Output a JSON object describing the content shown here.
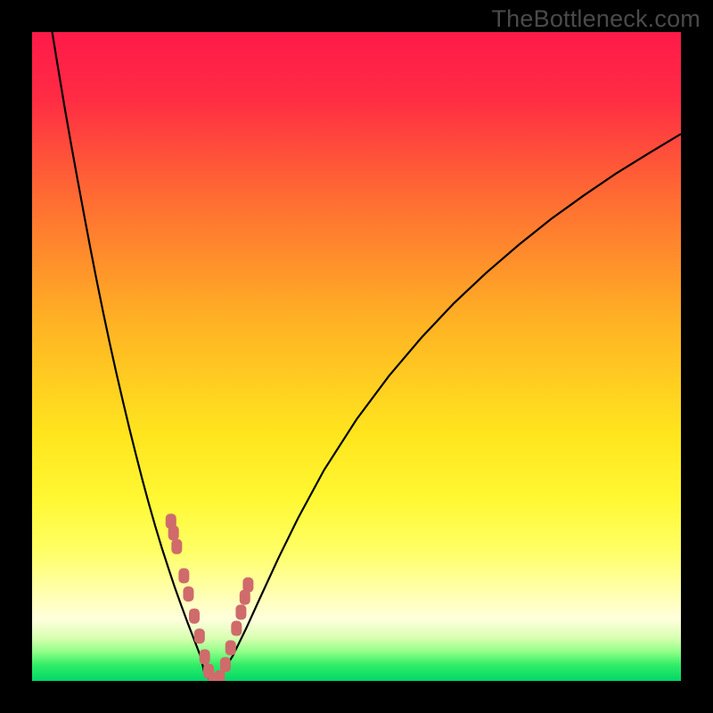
{
  "watermark": "TheBottleneck.com",
  "colors": {
    "frame": "#000000",
    "curve": "#000000",
    "marker_fill": "#cf6b6b",
    "marker_stroke": "#cf6b6b"
  },
  "gradient_stops": [
    {
      "offset": 0.0,
      "color": "#ff1a49"
    },
    {
      "offset": 0.1,
      "color": "#ff2b44"
    },
    {
      "offset": 0.25,
      "color": "#ff6a33"
    },
    {
      "offset": 0.45,
      "color": "#ffb324"
    },
    {
      "offset": 0.62,
      "color": "#ffe51e"
    },
    {
      "offset": 0.72,
      "color": "#fff833"
    },
    {
      "offset": 0.8,
      "color": "#ffff66"
    },
    {
      "offset": 0.86,
      "color": "#ffffaa"
    },
    {
      "offset": 0.905,
      "color": "#ffffdd"
    },
    {
      "offset": 0.935,
      "color": "#d6ffb0"
    },
    {
      "offset": 0.955,
      "color": "#90ff88"
    },
    {
      "offset": 0.975,
      "color": "#33ee66"
    },
    {
      "offset": 1.0,
      "color": "#00d76a"
    }
  ],
  "chart_data": {
    "type": "line",
    "title": "",
    "xlabel": "",
    "ylabel": "",
    "xlim": [
      0,
      100
    ],
    "ylim": [
      0,
      100
    ],
    "note": "Bottleneck-style V-curve. x is a normalized hardware balance parameter (0–100). y is bottleneck percentage (0 = perfect balance at the notch, 100 = fully bottlenecked). Background hue encodes the same y value (green≈0, red≈100). Values estimated from gridless figure.",
    "series": [
      {
        "name": "left-branch",
        "x": [
          3.1,
          4,
          5,
          6,
          7,
          8,
          9,
          10,
          11,
          12,
          13,
          14,
          15,
          16,
          17,
          18,
          19,
          20,
          21,
          22,
          23,
          24,
          25,
          26,
          26.5
        ],
        "y": [
          100,
          94.5,
          88.5,
          82.8,
          77.3,
          71.9,
          66.6,
          61.5,
          56.6,
          51.9,
          47.4,
          43.1,
          38.9,
          34.9,
          31.0,
          27.3,
          23.8,
          20.5,
          17.4,
          14.4,
          11.6,
          8.9,
          6.3,
          3.7,
          1.5
        ]
      },
      {
        "name": "valley",
        "x": [
          26.5,
          27,
          27.5,
          28,
          28.5,
          29,
          29.5
        ],
        "y": [
          1.5,
          0.6,
          0.1,
          0.0,
          0.1,
          0.6,
          1.5
        ]
      },
      {
        "name": "right-branch",
        "x": [
          29.5,
          31,
          33,
          35,
          38,
          41,
          45,
          50,
          55,
          60,
          65,
          70,
          75,
          80,
          85,
          90,
          95,
          100
        ],
        "y": [
          1.5,
          4.0,
          8.1,
          12.5,
          19.0,
          25.1,
          32.5,
          40.3,
          47.0,
          52.9,
          58.2,
          62.9,
          67.2,
          71.2,
          74.8,
          78.2,
          81.3,
          84.3
        ]
      }
    ],
    "markers": {
      "name": "highlighted-points",
      "shape": "rounded-rect",
      "x": [
        21.4,
        21.8,
        22.3,
        23.4,
        24.1,
        25.0,
        25.8,
        26.6,
        27.2,
        28.0,
        28.9,
        29.8,
        30.6,
        31.5,
        32.2,
        32.8,
        33.3
      ],
      "y": [
        24.6,
        22.8,
        20.7,
        16.2,
        13.4,
        10.0,
        6.9,
        3.7,
        1.5,
        0.0,
        0.5,
        2.5,
        5.1,
        8.1,
        10.6,
        12.9,
        14.8
      ]
    }
  }
}
